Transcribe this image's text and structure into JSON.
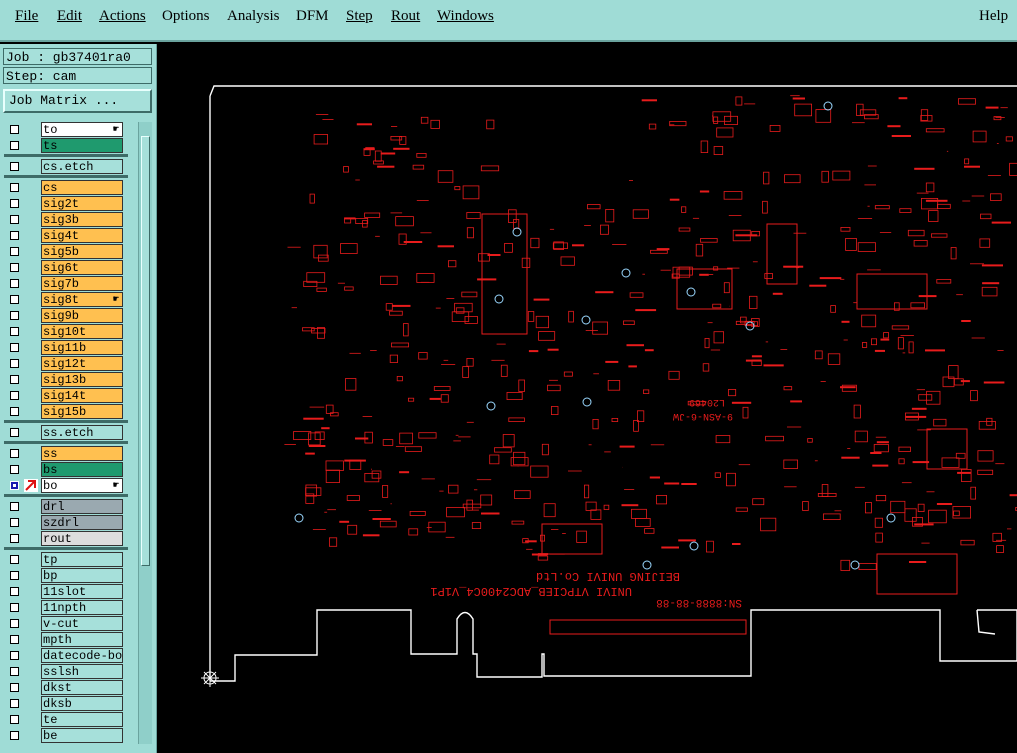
{
  "menu": {
    "file": "File",
    "edit": "Edit",
    "actions": "Actions",
    "options": "Options",
    "analysis": "Analysis",
    "dfm": "DFM",
    "step": "Step",
    "rout": "Rout",
    "windows": "Windows",
    "help": "Help"
  },
  "job": {
    "label": "Job : gb37401ra0",
    "step": "Step: cam",
    "matrix_button": "Job Matrix ..."
  },
  "layers": [
    {
      "name": "to",
      "color": "#ffffff"
    },
    {
      "name": "ts",
      "color": "#1f9a6e"
    },
    {
      "name": "cs.etch",
      "color": "#a6e0da"
    },
    {
      "name": "cs",
      "color": "#ffc050"
    },
    {
      "name": "sig2t",
      "color": "#ffc050"
    },
    {
      "name": "sig3b",
      "color": "#ffc050"
    },
    {
      "name": "sig4t",
      "color": "#ffc050"
    },
    {
      "name": "sig5b",
      "color": "#ffc050"
    },
    {
      "name": "sig6t",
      "color": "#ffc050"
    },
    {
      "name": "sig7b",
      "color": "#ffc050"
    },
    {
      "name": "sig8t",
      "color": "#ffc050"
    },
    {
      "name": "sig9b",
      "color": "#ffc050"
    },
    {
      "name": "sig10t",
      "color": "#ffc050"
    },
    {
      "name": "sig11b",
      "color": "#ffc050"
    },
    {
      "name": "sig12t",
      "color": "#ffc050"
    },
    {
      "name": "sig13b",
      "color": "#ffc050"
    },
    {
      "name": "sig14t",
      "color": "#ffc050"
    },
    {
      "name": "sig15b",
      "color": "#ffc050"
    },
    {
      "name": "ss.etch",
      "color": "#a6e0da"
    },
    {
      "name": "ss",
      "color": "#ffc050"
    },
    {
      "name": "bs",
      "color": "#1f9a6e"
    },
    {
      "name": "bo",
      "color": "#ffffff"
    },
    {
      "name": "drl",
      "color": "#9aa9b0"
    },
    {
      "name": "szdrl",
      "color": "#9aa9b0"
    },
    {
      "name": "rout",
      "color": "#dddddd"
    },
    {
      "name": "tp",
      "color": "#a6e0da"
    },
    {
      "name": "bp",
      "color": "#a6e0da"
    },
    {
      "name": "11slot",
      "color": "#a6e0da"
    },
    {
      "name": "11npth",
      "color": "#a6e0da"
    },
    {
      "name": "v-cut",
      "color": "#a6e0da"
    },
    {
      "name": "mpth",
      "color": "#a6e0da"
    },
    {
      "name": "datecode-bo",
      "color": "#a6e0da"
    },
    {
      "name": "sslsh",
      "color": "#a6e0da"
    },
    {
      "name": "dkst",
      "color": "#a6e0da"
    },
    {
      "name": "dksb",
      "color": "#a6e0da"
    },
    {
      "name": "te",
      "color": "#a6e0da"
    },
    {
      "name": "be",
      "color": "#a6e0da"
    }
  ],
  "board": {
    "silk_line1": "BEIJING UNIVI Co.Ltd",
    "silk_line2": "UNIVI VTPCIEB_ADC2400C4_V1P1",
    "silk_line3": "SN:8888-88-88",
    "chip_text1": "L20469",
    "chip_text2": "9-ASN-6-JW",
    "trace_color": "#e81c1c",
    "outline_color": "#ffffff",
    "via_color": "#9ad8ff"
  }
}
